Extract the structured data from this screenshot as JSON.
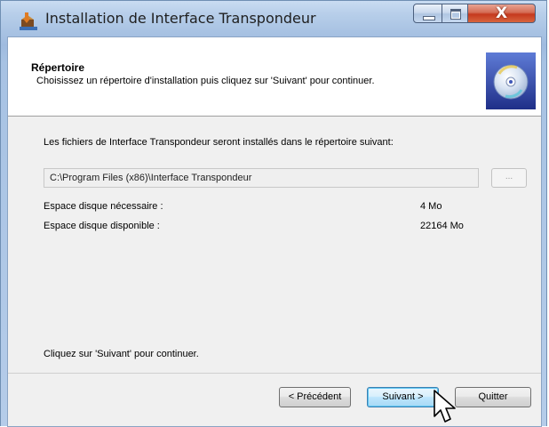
{
  "window": {
    "title": "Installation de Interface Transpondeur",
    "close_glyph": "X",
    "icons": {
      "app": "installer-icon",
      "min": "minimize-icon",
      "max": "maximize-icon",
      "close": "close-icon"
    }
  },
  "banner": {
    "title": "Répertoire",
    "subtitle": "Choisissez un répertoire d'installation puis cliquez sur 'Suivant' pour continuer.",
    "icon": "cd-disc-icon"
  },
  "body": {
    "intro": "Les fichiers de Interface Transpondeur seront installés dans le répertoire suivant:",
    "path_value": "C:\\Program Files (x86)\\Interface Transpondeur",
    "browse_label": "...",
    "space_required_label": "Espace disque nécessaire :",
    "space_required_value": "4 Mo",
    "space_available_label": "Espace disque disponible :",
    "space_available_value": "22164 Mo",
    "continue_hint": "Cliquez sur 'Suivant' pour continuer."
  },
  "buttons": {
    "previous": "< Précédent",
    "next": "Suivant >",
    "quit": "Quitter"
  },
  "colors": {
    "titlebar": "#a9c3e3",
    "close_button": "#c5391e",
    "focused_button_border": "#3c7fb1"
  }
}
